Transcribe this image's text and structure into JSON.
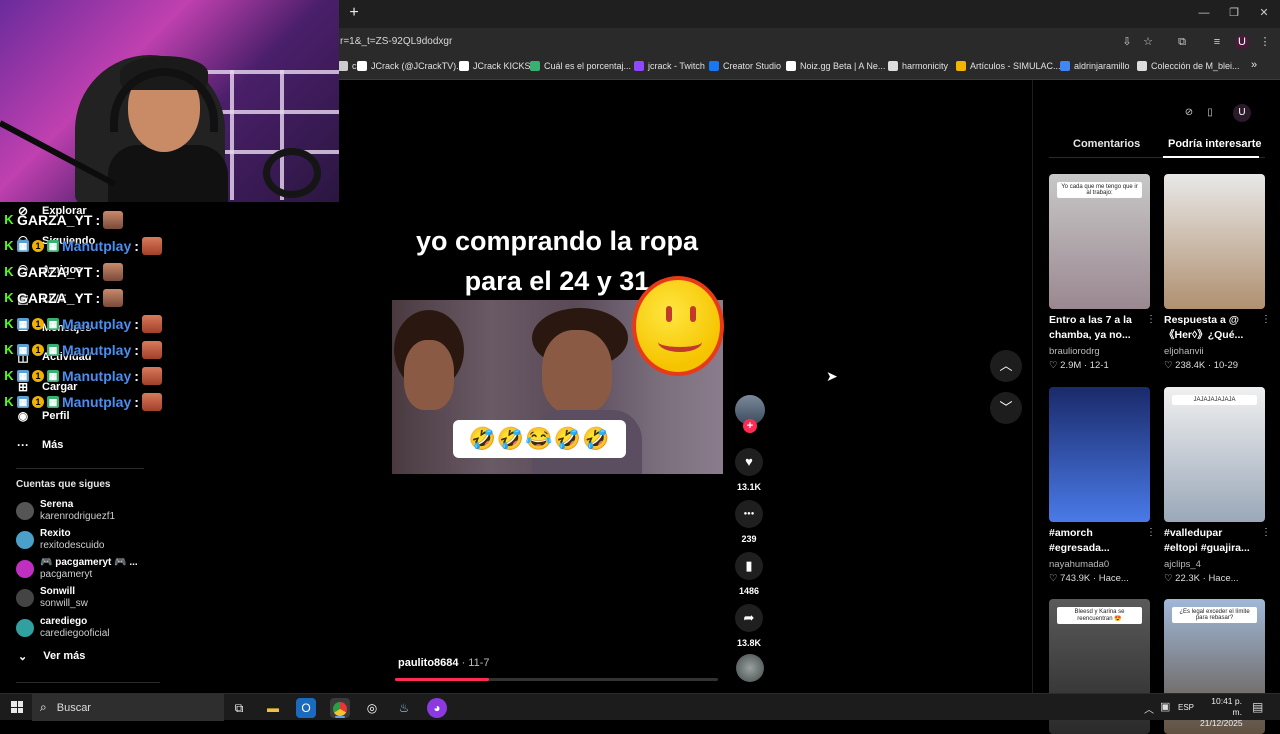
{
  "browser": {
    "url": "r=1&_t=ZS-92QL9dodxgr",
    "new_tab": "+",
    "window_controls": {
      "minimize": "—",
      "maximize": "❐",
      "close": "✕"
    },
    "bookmarks": [
      {
        "label": "ch",
        "icon": "bookmark-icon",
        "color": "#cccccc"
      },
      {
        "label": "JCrack (@JCrackTV)...",
        "icon": "x-icon",
        "color": "#ffffff"
      },
      {
        "label": "JCrack KICKS",
        "icon": "jcrack-icon",
        "color": "#ffffff"
      },
      {
        "label": "Cuál es el porcentaj...",
        "icon": "doc-icon",
        "color": "#3ab070"
      },
      {
        "label": "jcrack - Twitch",
        "icon": "twitch-icon",
        "color": "#9146ff"
      },
      {
        "label": "Creator Studio",
        "icon": "facebook-icon",
        "color": "#1877f2"
      },
      {
        "label": "Noiz.gg Beta | A Ne...",
        "icon": "noiz-icon",
        "color": "#ffffff"
      },
      {
        "label": "harmonicity",
        "icon": "page-icon",
        "color": "#dddddd"
      },
      {
        "label": "Artículos - SIMULAC...",
        "icon": "drive-icon",
        "color": "#f4b400"
      },
      {
        "label": "aldrinjaramillo",
        "icon": "page-icon",
        "color": "#4285f4"
      },
      {
        "label": "Colección de M_blei...",
        "icon": "page-icon",
        "color": "#dddddd"
      }
    ],
    "bookmarks_more": "»"
  },
  "sidebar": {
    "nav": [
      {
        "label": "Explorar",
        "icon": "compass-icon",
        "glyph": "⊘"
      },
      {
        "label": "Siguiendo",
        "icon": "following-icon",
        "glyph": "⚇"
      },
      {
        "label": "Amigos",
        "icon": "friends-icon",
        "glyph": "⚇"
      },
      {
        "label": "LIVE",
        "icon": "live-icon",
        "glyph": "▣"
      },
      {
        "label": "Mensajes",
        "icon": "messages-icon",
        "glyph": "✉"
      },
      {
        "label": "Actividad",
        "icon": "activity-icon",
        "glyph": "◫"
      },
      {
        "label": "Cargar",
        "icon": "upload-icon",
        "glyph": "⊞"
      },
      {
        "label": "Perfil",
        "icon": "profile-icon",
        "glyph": "◉"
      },
      {
        "label": "Más",
        "icon": "more-icon",
        "glyph": "···"
      }
    ],
    "following_title": "Cuentas que sigues",
    "accounts": [
      {
        "name": "Serena",
        "handle": "karenrodriguezf1",
        "color": "#555555"
      },
      {
        "name": "Rexito",
        "handle": "rexitodescuido",
        "color": "#4aa0c8"
      },
      {
        "name": "🎮 pacgameryt 🎮 ...",
        "handle": "pacgameryt",
        "color": "#c030c0"
      },
      {
        "name": "Sonwill",
        "handle": "sonwill_sw",
        "color": "#444444"
      },
      {
        "name": "carediego",
        "handle": "carediegooficial",
        "color": "#30a0a0"
      }
    ],
    "see_more": "Ver más",
    "see_more_icon": "⌄"
  },
  "chat": [
    {
      "user": "GARZA_YT",
      "color": "#ffffff",
      "badges": [
        "k"
      ]
    },
    {
      "user": "Manutplay",
      "color": "#4a8ef0",
      "badges": [
        "k",
        "sub",
        "coin",
        "gift"
      ]
    },
    {
      "user": "GARZA_YT",
      "color": "#ffffff",
      "badges": [
        "k"
      ]
    },
    {
      "user": "GARZA_YT",
      "color": "#ffffff",
      "badges": [
        "k"
      ]
    },
    {
      "user": "Manutplay",
      "color": "#4a8ef0",
      "badges": [
        "k",
        "sub",
        "coin",
        "gift"
      ]
    },
    {
      "user": "Manutplay",
      "color": "#4a8ef0",
      "badges": [
        "k",
        "sub",
        "coin",
        "gift"
      ]
    },
    {
      "user": "Manutplay",
      "color": "#4a8ef0",
      "badges": [
        "k",
        "sub",
        "coin",
        "gift"
      ]
    },
    {
      "user": "Manutplay",
      "color": "#4a8ef0",
      "badges": [
        "k",
        "sub",
        "coin",
        "gift"
      ]
    }
  ],
  "video": {
    "caption_line1": "yo comprando la ropa",
    "caption_line2": "para el 24 y 31",
    "emoji_strip": "🤣🤣😂🤣🤣",
    "author": "paulito8684",
    "date": " · 11-7",
    "progress_fraction": 0.29,
    "actions": [
      {
        "icon": "heart-icon",
        "glyph": "♥",
        "count": "13.1K"
      },
      {
        "icon": "comment-icon",
        "glyph": "●●●",
        "count": "239"
      },
      {
        "icon": "bookmark-icon",
        "glyph": "▮",
        "count": "1486"
      },
      {
        "icon": "share-icon",
        "glyph": "➦",
        "count": "13.8K"
      }
    ],
    "follow_plus": "+",
    "nav_up": "︿",
    "nav_down": "﹀"
  },
  "right_panel": {
    "tabs": [
      "Comentarios",
      "Podría interesarte"
    ],
    "active_tab": 1,
    "cards": [
      {
        "title": "Entro a las 7 a la chamba, ya no...",
        "author": "brauliorodrg",
        "likes": "2.9M",
        "date": "12-1",
        "thumb_text": "Yo cada que me tengo que ir al trabajo:",
        "colors": [
          "#c8c8c8",
          "#9a8890"
        ]
      },
      {
        "title": "Respuesta a @ 《Her◊》¿Qué...",
        "author": "eljohanvii",
        "likes": "238.4K",
        "date": "10-29",
        "thumb_text": "",
        "colors": [
          "#e8e8e8",
          "#b09070"
        ]
      },
      {
        "title": "#amorch #egresada...",
        "author": "nayahumada0",
        "likes": "743.9K",
        "date": "Hace...",
        "thumb_text": "",
        "colors": [
          "#1a2a6a",
          "#4a7ae8"
        ]
      },
      {
        "title": "#valledupar #eltopi #guajira...",
        "author": "ajclips_4",
        "likes": "22.3K",
        "date": "Hace...",
        "thumb_text": "JAJAJAJAJAJA",
        "colors": [
          "#f0f0f0",
          "#9aa8b8"
        ]
      },
      {
        "title": "",
        "author": "",
        "likes": "",
        "date": "",
        "thumb_text": "Bleesd y Karina se reencuentran 😍",
        "colors": [
          "#5a5a5a",
          "#2a2a2a"
        ]
      },
      {
        "title": "",
        "author": "",
        "likes": "",
        "date": "",
        "thumb_text": "¿Es legal exceder el límite para rebasar?",
        "colors": [
          "#a0b8d8",
          "#605040"
        ]
      }
    ]
  },
  "taskbar": {
    "search": "Buscar",
    "lang": "ESP",
    "time": "10:41 p. m.",
    "date": "21/12/2025"
  }
}
